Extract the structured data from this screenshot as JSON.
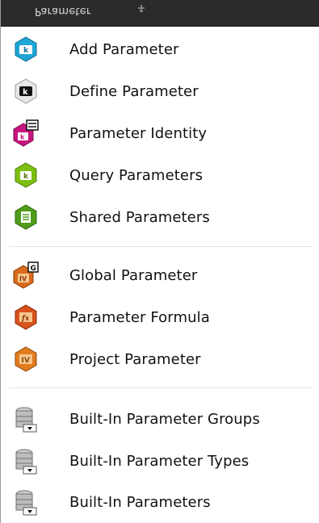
{
  "menu": {
    "title": "Parameter",
    "sections": [
      {
        "items": [
          {
            "label": "Add Parameter",
            "icon": "parameter-k-icon",
            "color": "#1fa6d6"
          },
          {
            "label": "Define Parameter",
            "icon": "parameter-k-icon",
            "color": "#1a1a1a"
          },
          {
            "label": "Parameter Identity",
            "icon": "parameter-identity-icon",
            "color": "#c7157f"
          },
          {
            "label": "Query Parameters",
            "icon": "query-parameters-icon",
            "color": "#7bbf10"
          },
          {
            "label": "Shared Parameters",
            "icon": "shared-parameters-icon",
            "color": "#4f9c1a"
          }
        ]
      },
      {
        "items": [
          {
            "label": "Global Parameter",
            "icon": "global-parameter-icon",
            "color": "#d86a1c"
          },
          {
            "label": "Parameter Formula",
            "icon": "parameter-formula-icon",
            "color": "#d8521c"
          },
          {
            "label": "Project Parameter",
            "icon": "project-parameter-icon",
            "color": "#e27c1c"
          }
        ]
      },
      {
        "items": [
          {
            "label": "Built-In Parameter Groups",
            "icon": "database-icon",
            "color": "#8a8a8a"
          },
          {
            "label": "Built-In Parameter Types",
            "icon": "database-icon",
            "color": "#8a8a8a"
          },
          {
            "label": "Built-In Parameters",
            "icon": "database-icon",
            "color": "#8a8a8a"
          }
        ]
      }
    ]
  }
}
